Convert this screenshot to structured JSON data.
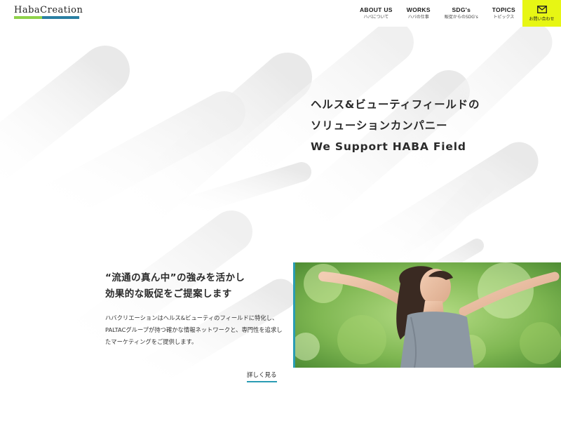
{
  "header": {
    "logo_text": "HabaCreation",
    "nav": [
      {
        "label": "ABOUT US",
        "sub": "ハバについて"
      },
      {
        "label": "WORKS",
        "sub": "ハバの仕事"
      },
      {
        "label": "SDG's",
        "sub": "販促からのSDG's"
      },
      {
        "label": "TOPICS",
        "sub": "トピックス"
      }
    ],
    "contact_label": "お問い合わせ",
    "contact_icon": "mail-icon",
    "accent_color": "#e7f614"
  },
  "hero": {
    "line1": "ヘルス&ビューティフィールドの",
    "line2": "ソリューションカンパニー",
    "line3": "We Support HABA Field"
  },
  "intro": {
    "heading1": "“流通の真ん中”の強みを活かし",
    "heading2": "効果的な販促をご提案します",
    "body": "ハバクリエーションはヘルス&ビューティのフィールドに特化し、PALTACグループが持つ確かな情報ネットワークと、専門性を追求したマーケティングをご提供します。",
    "more_label": "詳しく見る",
    "accent_color": "#2a9cb3"
  },
  "photo": {
    "icon": "woman-stretching-photo"
  }
}
